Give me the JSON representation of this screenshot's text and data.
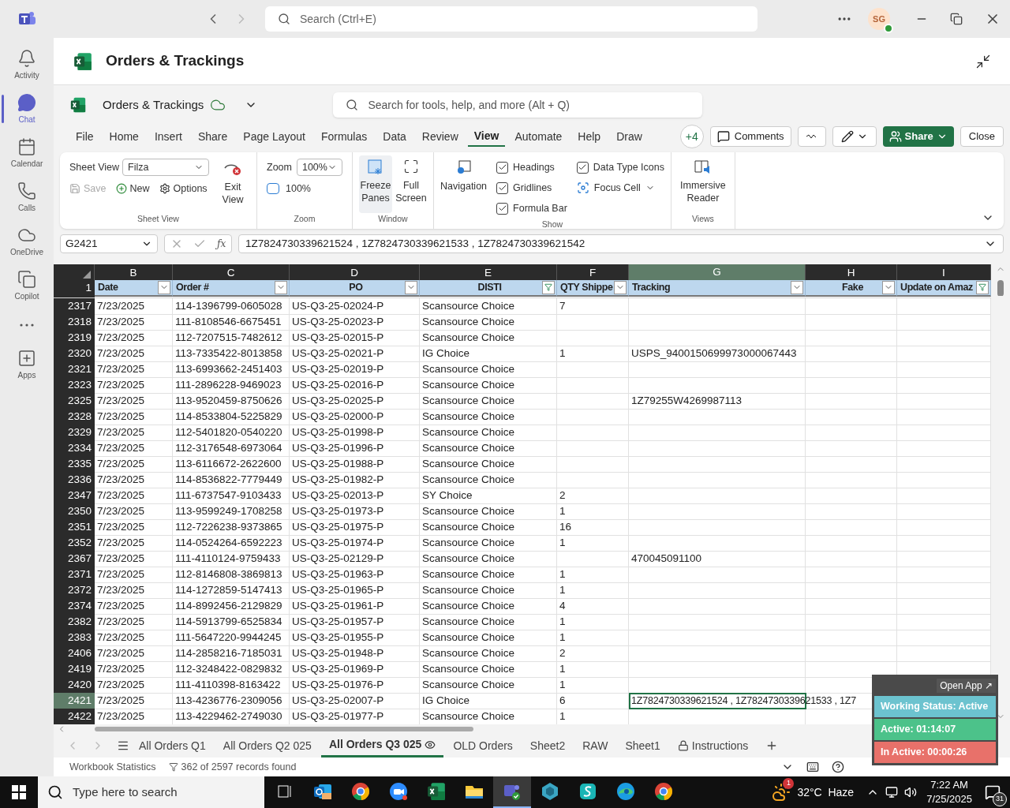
{
  "teams": {
    "search": {
      "placeholder": "Search (Ctrl+E)"
    },
    "avatar": "SG",
    "rail": [
      {
        "label": "Activity",
        "kind": "bell",
        "selected": false
      },
      {
        "label": "Chat",
        "kind": "chat",
        "selected": true
      },
      {
        "label": "Calendar",
        "kind": "calendar",
        "selected": false
      },
      {
        "label": "Calls",
        "kind": "phone",
        "selected": false
      },
      {
        "label": "OneDrive",
        "kind": "cloud",
        "selected": false
      },
      {
        "label": "Copilot",
        "kind": "copilot",
        "selected": false
      },
      {
        "kind": "more",
        "selected": false
      },
      {
        "label": "Apps",
        "kind": "apps",
        "selected": false
      }
    ]
  },
  "document_title": "Orders & Trackings",
  "excel": {
    "file_name": "Orders & Trackings",
    "search": {
      "placeholder": "Search for tools, help, and more (Alt + Q)"
    },
    "tabs": [
      {
        "label": "File",
        "selected": false
      },
      {
        "label": "Home",
        "selected": false
      },
      {
        "label": "Insert",
        "selected": false
      },
      {
        "label": "Share",
        "selected": false
      },
      {
        "label": "Page Layout",
        "selected": false
      },
      {
        "label": "Formulas",
        "selected": false
      },
      {
        "label": "Data",
        "selected": false
      },
      {
        "label": "Review",
        "selected": false
      },
      {
        "label": "View",
        "selected": true
      },
      {
        "label": "Automate",
        "selected": false
      },
      {
        "label": "Help",
        "selected": false
      },
      {
        "label": "Draw",
        "selected": false
      }
    ],
    "collaborators": "+4",
    "comments": "Comments",
    "share": "Share",
    "close": "Close",
    "ribbon": {
      "sheet_view_label": "Sheet View",
      "sheet_view_value": "Filza",
      "save": "Save",
      "new": "New",
      "options": "Options",
      "exit_view": "Exit View",
      "group_sheet_view": "Sheet View",
      "zoom_label": "Zoom",
      "zoom_value": "100%",
      "zoom_100": "100%",
      "group_zoom": "Zoom",
      "freeze_panes": "Freeze Panes",
      "full_screen": "Full Screen",
      "group_window": "Window",
      "navigation": "Navigation",
      "show_checks": [
        {
          "label": "Headings",
          "checked": true
        },
        {
          "label": "Gridlines",
          "checked": true
        },
        {
          "label": "Formula Bar",
          "checked": true
        },
        {
          "label": "Data Type Icons",
          "checked": true
        }
      ],
      "focus_cell": "Focus Cell",
      "group_show": "Show",
      "immersive_reader": "Immersive Reader",
      "group_views": "Views"
    },
    "name_box": "G2421",
    "formula": "1Z7824730339621524 , 1Z7824730339621533 , 1Z7824730339621542",
    "column_letters": [
      {
        "label": "B",
        "selected": false
      },
      {
        "label": "C",
        "selected": false
      },
      {
        "label": "D",
        "selected": false
      },
      {
        "label": "E",
        "selected": false
      },
      {
        "label": "F",
        "selected": false
      },
      {
        "label": "G",
        "selected": true
      },
      {
        "label": "H",
        "selected": false
      },
      {
        "label": "I",
        "selected": false
      }
    ],
    "header_row": "1",
    "fx_label": "ƒx",
    "headers": [
      {
        "label": "Date",
        "filtered": false,
        "centered": false
      },
      {
        "label": "Order #",
        "filtered": false,
        "centered": false
      },
      {
        "label": "PO",
        "filtered": false,
        "centered": true
      },
      {
        "label": "DISTI",
        "filtered": true,
        "centered": true
      },
      {
        "label": "QTY Shippe",
        "filtered": false,
        "centered": false
      },
      {
        "label": "Tracking",
        "filtered": false,
        "centered": false
      },
      {
        "label": "Fake",
        "filtered": false,
        "centered": true
      },
      {
        "label": "Update on Amaz",
        "filtered": true,
        "centered": false
      }
    ],
    "rows": [
      {
        "num": "2317",
        "date": "7/23/2025",
        "order": "114-1396799-0605028",
        "po": "US-Q3-25-02024-P",
        "disti": "Scansource Choice",
        "qty": "7",
        "selected": false
      },
      {
        "num": "2318",
        "date": "7/23/2025",
        "order": "111-8108546-6675451",
        "po": "US-Q3-25-02023-P",
        "disti": "Scansource Choice",
        "selected": false
      },
      {
        "num": "2319",
        "date": "7/23/2025",
        "order": "112-7207515-7482612",
        "po": "US-Q3-25-02015-P",
        "disti": "Scansource Choice",
        "selected": false
      },
      {
        "num": "2320",
        "date": "7/23/2025",
        "order": "113-7335422-8013858",
        "po": "US-Q3-25-02021-P",
        "disti": "IG Choice",
        "qty": "1",
        "tracking": "USPS_9400150699973000067443",
        "selected": false
      },
      {
        "num": "2321",
        "date": "7/23/2025",
        "order": "113-6993662-2451403",
        "po": "US-Q3-25-02019-P",
        "disti": "Scansource Choice",
        "selected": false
      },
      {
        "num": "2323",
        "date": "7/23/2025",
        "order": "111-2896228-9469023",
        "po": "US-Q3-25-02016-P",
        "disti": "Scansource Choice",
        "selected": false
      },
      {
        "num": "2325",
        "date": "7/23/2025",
        "order": "113-9520459-8750626",
        "po": "US-Q3-25-02025-P",
        "disti": "Scansource Choice",
        "tracking": "1Z79255W4269987113",
        "selected": false
      },
      {
        "num": "2328",
        "date": "7/23/2025",
        "order": "114-8533804-5225829",
        "po": "US-Q3-25-02000-P",
        "disti": "Scansource Choice",
        "selected": false
      },
      {
        "num": "2329",
        "date": "7/23/2025",
        "order": "112-5401820-0540220",
        "po": "US-Q3-25-01998-P",
        "disti": "Scansource Choice",
        "selected": false
      },
      {
        "num": "2334",
        "date": "7/23/2025",
        "order": "112-3176548-6973064",
        "po": "US-Q3-25-01996-P",
        "disti": "Scansource Choice",
        "selected": false
      },
      {
        "num": "2335",
        "date": "7/23/2025",
        "order": "113-6116672-2622600",
        "po": "US-Q3-25-01988-P",
        "disti": "Scansource Choice",
        "selected": false
      },
      {
        "num": "2336",
        "date": "7/23/2025",
        "order": "114-8536822-7779449",
        "po": "US-Q3-25-01982-P",
        "disti": "Scansource Choice",
        "selected": false
      },
      {
        "num": "2347",
        "date": "7/23/2025",
        "order": "111-6737547-9103433",
        "po": "US-Q3-25-02013-P",
        "disti": "SY Choice",
        "qty": "2",
        "selected": false
      },
      {
        "num": "2350",
        "date": "7/23/2025",
        "order": "113-9599249-1708258",
        "po": "US-Q3-25-01973-P",
        "disti": "Scansource Choice",
        "qty": "1",
        "selected": false
      },
      {
        "num": "2351",
        "date": "7/23/2025",
        "order": "112-7226238-9373865",
        "po": "US-Q3-25-01975-P",
        "disti": "Scansource Choice",
        "qty": "16",
        "selected": false
      },
      {
        "num": "2352",
        "date": "7/23/2025",
        "order": "114-0524264-6592223",
        "po": "US-Q3-25-01974-P",
        "disti": "Scansource Choice",
        "qty": "1",
        "selected": false
      },
      {
        "num": "2367",
        "date": "7/23/2025",
        "order": "111-4110124-9759433",
        "po": "US-Q3-25-02129-P",
        "disti": "Scansource Choice",
        "tracking": "470045091100",
        "selected": false
      },
      {
        "num": "2371",
        "date": "7/23/2025",
        "order": "112-8146808-3869813",
        "po": "US-Q3-25-01963-P",
        "disti": "Scansource Choice",
        "qty": "1",
        "selected": false
      },
      {
        "num": "2372",
        "date": "7/23/2025",
        "order": "114-1272859-5147413",
        "po": "US-Q3-25-01965-P",
        "disti": "Scansource Choice",
        "qty": "1",
        "selected": false
      },
      {
        "num": "2374",
        "date": "7/23/2025",
        "order": "114-8992456-2129829",
        "po": "US-Q3-25-01961-P",
        "disti": "Scansource Choice",
        "qty": "4",
        "selected": false
      },
      {
        "num": "2382",
        "date": "7/23/2025",
        "order": "114-5913799-6525834",
        "po": "US-Q3-25-01957-P",
        "disti": "Scansource Choice",
        "qty": "1",
        "selected": false
      },
      {
        "num": "2383",
        "date": "7/23/2025",
        "order": "111-5647220-9944245",
        "po": "US-Q3-25-01955-P",
        "disti": "Scansource Choice",
        "qty": "1",
        "selected": false
      },
      {
        "num": "2406",
        "date": "7/23/2025",
        "order": "114-2858216-7185031",
        "po": "US-Q3-25-01948-P",
        "disti": "Scansource Choice",
        "qty": "2",
        "selected": false
      },
      {
        "num": "2419",
        "date": "7/23/2025",
        "order": "112-3248422-0829832",
        "po": "US-Q3-25-01969-P",
        "disti": "Scansource Choice",
        "qty": "1",
        "selected": false
      },
      {
        "num": "2420",
        "date": "7/23/2025",
        "order": "111-4110398-8163422",
        "po": "US-Q3-25-01976-P",
        "disti": "Scansource Choice",
        "qty": "1",
        "selected": false
      },
      {
        "num": "2421",
        "date": "7/23/2025",
        "order": "113-4236776-2309056",
        "po": "US-Q3-25-02007-P",
        "disti": "IG Choice",
        "qty": "6",
        "tracking": "1Z7824730339621524 , 1Z7824730339621533 , 1Z7",
        "selected": true
      },
      {
        "num": "2422",
        "date": "7/23/2025",
        "order": "113-4229462-2749030",
        "po": "US-Q3-25-01977-P",
        "disti": "Scansource Choice",
        "qty": "1",
        "selected": false
      }
    ],
    "sheets": [
      {
        "label": "All Orders Q1",
        "kind": "plain",
        "selected": false
      },
      {
        "label": "All Orders Q2 025",
        "kind": "plain",
        "selected": false
      },
      {
        "label": "All Orders Q3 025",
        "kind": "sheet-view",
        "selected": true
      },
      {
        "label": "OLD Orders",
        "kind": "plain",
        "selected": false
      },
      {
        "label": "Sheet2",
        "kind": "plain",
        "selected": false
      },
      {
        "label": "RAW",
        "kind": "plain",
        "selected": false
      },
      {
        "label": "Sheet1",
        "kind": "plain",
        "selected": false
      },
      {
        "label": "Instructions",
        "kind": "locked",
        "selected": false
      }
    ],
    "status": {
      "stats": "Workbook Statistics",
      "records": "362 of 2597 records found"
    }
  },
  "tracker_widget": {
    "open_app": "Open App ↗",
    "lines": [
      {
        "text": "Working Status: Active",
        "color": "#6cc3cf"
      },
      {
        "text": "Active: 01:14:07",
        "color": "#4cc28a"
      },
      {
        "text": "In Active: 00:00:26",
        "color": "#e8716a"
      }
    ]
  },
  "taskbar": {
    "search": {
      "placeholder": "Type here to search"
    },
    "apps": [
      {
        "kind": "taskview",
        "active": false
      },
      {
        "kind": "outlook",
        "active": false
      },
      {
        "kind": "chrome",
        "active": false
      },
      {
        "kind": "zoom",
        "active": false
      },
      {
        "kind": "excel",
        "active": false
      },
      {
        "kind": "folder",
        "active": false
      },
      {
        "kind": "teams",
        "active": true
      },
      {
        "kind": "hex",
        "active": false
      },
      {
        "kind": "vpn",
        "active": false
      },
      {
        "kind": "edge",
        "active": false
      },
      {
        "kind": "chrome",
        "active": false
      }
    ],
    "weather": "32°C  Haze",
    "weather_badge": "1",
    "time": "7:22 AM",
    "date": "7/25/2025",
    "notifications": "31"
  }
}
